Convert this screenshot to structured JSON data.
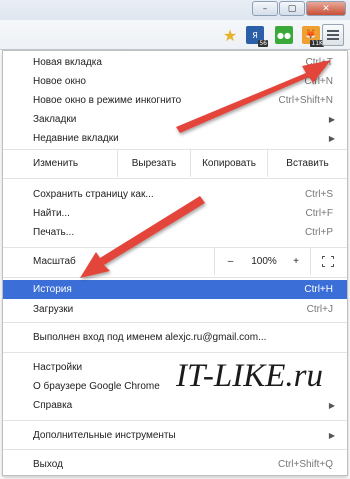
{
  "window": {
    "controls": {
      "minimize": "–",
      "maximize": "▢",
      "close": "✕"
    }
  },
  "toolbar": {
    "icons": [
      "star-icon",
      "extension-icon-1",
      "extension-icon-2",
      "extension-icon-3",
      "menu-icon"
    ],
    "ext1_badge": "56",
    "ext3_badge": "11K",
    "ext2_glyph": "●●",
    "ext1_glyph": "Я",
    "ext3_glyph": "🦊"
  },
  "menu": {
    "top_items": [
      {
        "label": "Новая вкладка",
        "shortcut": "Ctrl+T"
      },
      {
        "label": "Новое окно",
        "shortcut": "Ctrl+N"
      },
      {
        "label": "Новое окно в режиме инкогнито",
        "shortcut": "Ctrl+Shift+N"
      },
      {
        "label": "Закладки",
        "shortcut": ""
      },
      {
        "label": "Недавние вкладки",
        "shortcut": ""
      }
    ],
    "edit": {
      "label": "Изменить",
      "cut": "Вырезать",
      "copy": "Копировать",
      "paste": "Вставить"
    },
    "page_items": [
      {
        "label": "Сохранить страницу как...",
        "shortcut": "Ctrl+S"
      },
      {
        "label": "Найти...",
        "shortcut": "Ctrl+F"
      },
      {
        "label": "Печать...",
        "shortcut": "Ctrl+P"
      }
    ],
    "zoom": {
      "label": "Масштаб",
      "minus": "–",
      "value": "100%",
      "plus": "+"
    },
    "history": {
      "label": "История",
      "shortcut": "Ctrl+H"
    },
    "downloads": {
      "label": "Загрузки",
      "shortcut": "Ctrl+J"
    },
    "signed_in": "Выполнен вход под именем alexjc.ru@gmail.com...",
    "settings_items": [
      {
        "label": "Настройки"
      },
      {
        "label": "О браузере Google Chrome"
      },
      {
        "label": "Справка"
      }
    ],
    "tools": {
      "label": "Дополнительные инструменты"
    },
    "exit": {
      "label": "Выход",
      "shortcut": "Ctrl+Shift+Q"
    }
  },
  "watermark": "IT-LIKE.ru",
  "colors": {
    "highlight": "#3b6ed7",
    "arrow": "#e4453a"
  }
}
